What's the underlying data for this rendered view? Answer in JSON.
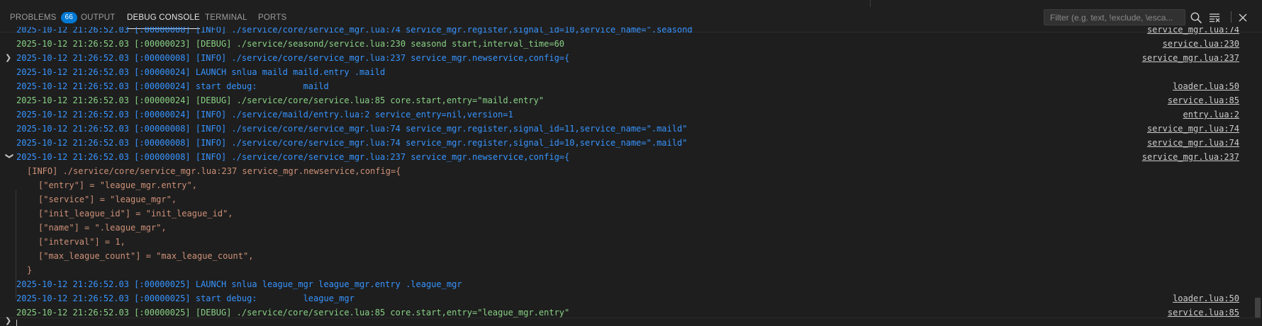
{
  "tabs": [
    {
      "label": "PROBLEMS",
      "badge": "66"
    },
    {
      "label": "OUTPUT"
    },
    {
      "label": "DEBUG CONSOLE"
    },
    {
      "label": "TERMINAL"
    },
    {
      "label": "PORTS"
    }
  ],
  "filter": {
    "placeholder": "Filter (e.g. text, !exclude, \\esca..."
  },
  "toolbar_icons": [
    "search-icon",
    "clear-console-icon",
    "close-panel-icon"
  ],
  "colors": {
    "info": "#3794ff",
    "debug": "#89d185",
    "config": "#ce9178",
    "accent": "#0078d4"
  },
  "log": [
    {
      "text": "2025-10-12 21:26:52.03 [:00000008] [INFO] ./service/core/service_mgr.lua:74 service_mgr.register,signal_id=10,service_name=\".seasond",
      "src": "service_mgr.lua:74",
      "level": "info"
    },
    {
      "text": "2025-10-12 21:26:52.03 [:00000023] [DEBUG] ./service/seasond/service.lua:230 seasond start,interval_time=60",
      "src": "service.lua:230",
      "level": "debug"
    },
    {
      "text": "2025-10-12 21:26:52.03 [:00000008] [INFO] ./service/core/service_mgr.lua:237 service_mgr.newservice,config={",
      "src": "service_mgr.lua:237",
      "level": "info",
      "chevron": "collapsed"
    },
    {
      "text": "2025-10-12 21:26:52.03 [:00000024] LAUNCH snlua maild maild.entry .maild",
      "src": "",
      "level": "info"
    },
    {
      "text": "2025-10-12 21:26:52.03 [:00000024] start debug:         maild",
      "src": "loader.lua:50",
      "level": "info"
    },
    {
      "text": "2025-10-12 21:26:52.03 [:00000024] [DEBUG] ./service/core/service.lua:85 core.start,entry=\"maild.entry\"",
      "src": "service.lua:85",
      "level": "debug"
    },
    {
      "text": "2025-10-12 21:26:52.03 [:00000024] [INFO] ./service/maild/entry.lua:2 service_entry=nil,version=1",
      "src": "entry.lua:2",
      "level": "info"
    },
    {
      "text": "2025-10-12 21:26:52.03 [:00000008] [INFO] ./service/core/service_mgr.lua:74 service_mgr.register,signal_id=11,service_name=\".maild\"",
      "src": "service_mgr.lua:74",
      "level": "info"
    },
    {
      "text": "2025-10-12 21:26:52.03 [:00000008] [INFO] ./service/core/service_mgr.lua:74 service_mgr.register,signal_id=10,service_name=\".maild\"",
      "src": "service_mgr.lua:74",
      "level": "info"
    },
    {
      "text": "2025-10-12 21:26:52.03 [:00000008] [INFO] ./service/core/service_mgr.lua:237 service_mgr.newservice,config={",
      "src": "service_mgr.lua:237",
      "level": "info",
      "chevron": "expanded"
    }
  ],
  "expanded": {
    "header": "[INFO] ./service/core/service_mgr.lua:237 service_mgr.newservice,config={",
    "entries": [
      "[\"entry\"] = \"league_mgr.entry\",",
      "[\"service\"] = \"league_mgr\",",
      "[\"init_league_id\"] = \"init_league_id\",",
      "[\"name\"] = \".league_mgr\",",
      "[\"interval\"] = 1,",
      "[\"max_league_count\"] = \"max_league_count\","
    ],
    "footer": "}"
  },
  "log_after": [
    {
      "text": "2025-10-12 21:26:52.03 [:00000025] LAUNCH snlua league_mgr league_mgr.entry .league_mgr",
      "src": "",
      "level": "info"
    },
    {
      "text": "2025-10-12 21:26:52.03 [:00000025] start debug:         league_mgr",
      "src": "loader.lua:50",
      "level": "info"
    },
    {
      "text": "2025-10-12 21:26:52.03 [:00000025] [DEBUG] ./service/core/service.lua:85 core.start,entry=\"league_mgr.entry\"",
      "src": "service.lua:85",
      "level": "debug"
    }
  ]
}
